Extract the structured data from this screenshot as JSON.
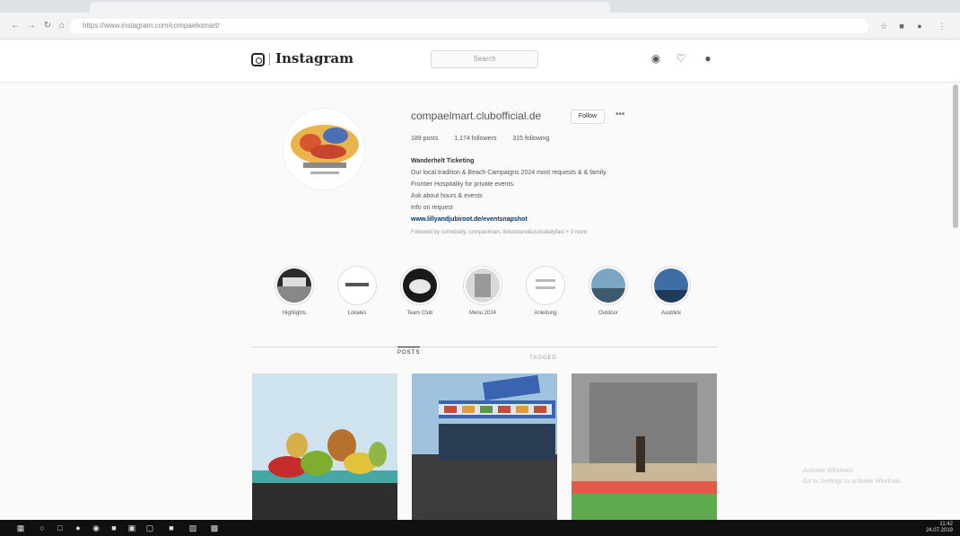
{
  "browser": {
    "url": "https://www.instagram.com/compaeliomart/"
  },
  "header": {
    "logo_text": "Instagram",
    "search_placeholder": "Search"
  },
  "profile": {
    "username": "compaelmart.clubofficial.de",
    "follow_label": "Follow",
    "posts": "189 posts",
    "followers": "1,174 followers",
    "following": "315 following",
    "bio_name": "Wanderhelt Ticketing",
    "bio_lines": [
      "Our local tradition & Beach Campaigns 2024 most requests & & family.",
      "Frontier Hospitality for private events.",
      "Ask about hours & events",
      "Info on request"
    ],
    "bio_link": "www.lillyandjubiroot.de/eventsnapshot",
    "followed_by": "Followed by somebody, compaelmart, ticketstand&clubsdailyfact + 3 more"
  },
  "highlights": [
    {
      "label": "Highlights"
    },
    {
      "label": "Lokales"
    },
    {
      "label": "Team Club"
    },
    {
      "label": "Menu 2024"
    },
    {
      "label": "Anleitung"
    },
    {
      "label": "Outdoor"
    },
    {
      "label": "Ausblick"
    }
  ],
  "tabs": {
    "posts": "POSTS",
    "tagged": "TAGGED"
  },
  "watermark": {
    "line1": "Activate Windows",
    "line2": "Go to Settings to activate Windows."
  },
  "taskbar": {
    "time": "11:42",
    "date": "24.07.2019"
  },
  "colors": {
    "accent": "#0095f6",
    "link": "#00376b",
    "taskbar": "#101010"
  }
}
